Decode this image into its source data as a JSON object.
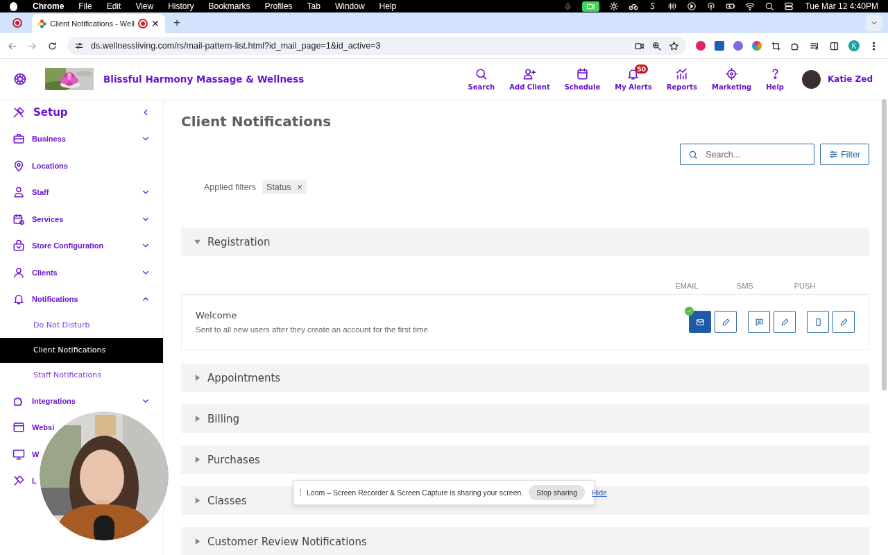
{
  "menubar": {
    "app": "Chrome",
    "menus": [
      "File",
      "Edit",
      "View",
      "History",
      "Bookmarks",
      "Profiles",
      "Tab",
      "Window",
      "Help"
    ],
    "clock": "Tue Mar 12  4:40PM"
  },
  "browser": {
    "tab_title": "Client Notifications - Well",
    "close_tab": "✕",
    "new_tab": "+",
    "url": "ds.wellnessliving.com/rs/mail-pattern-list.html?id_mail_page=1&id_active=3",
    "profile_initial": "K"
  },
  "header": {
    "business_name": "Blissful Harmony Massage & Wellness",
    "nav": [
      {
        "label": "Search"
      },
      {
        "label": "Add Client"
      },
      {
        "label": "Schedule"
      },
      {
        "label": "My Alerts",
        "badge": "50"
      },
      {
        "label": "Reports"
      },
      {
        "label": "Marketing"
      },
      {
        "label": "Help"
      }
    ],
    "user": "Katie Zed"
  },
  "sidebar": {
    "title": "Setup",
    "items": [
      {
        "label": "Business",
        "kind": "group",
        "expanded": false
      },
      {
        "label": "Locations",
        "kind": "link"
      },
      {
        "label": "Staff",
        "kind": "group",
        "expanded": false
      },
      {
        "label": "Services",
        "kind": "group",
        "expanded": false
      },
      {
        "label": "Store Configuration",
        "kind": "group",
        "expanded": false
      },
      {
        "label": "Clients",
        "kind": "group",
        "expanded": false
      },
      {
        "label": "Notifications",
        "kind": "group",
        "expanded": true,
        "children": [
          {
            "label": "Do Not Disturb",
            "selected": false
          },
          {
            "label": "Client Notifications",
            "selected": true
          },
          {
            "label": "Staff Notifications",
            "selected": false
          }
        ]
      },
      {
        "label": "Integrations",
        "kind": "group",
        "expanded": false
      },
      {
        "label": "Websi",
        "kind": "link"
      },
      {
        "label": "W",
        "kind": "link"
      },
      {
        "label": "L",
        "kind": "link"
      }
    ]
  },
  "main": {
    "title": "Client Notifications",
    "search": {
      "placeholder": "Search..."
    },
    "filter_button": "Filter",
    "applied_filters": {
      "label": "Applied filters",
      "chips": [
        {
          "label": "Status",
          "remove": "×"
        }
      ]
    },
    "sections": [
      {
        "title": "Registration",
        "expanded": true,
        "columns": [
          "EMAIL",
          "SMS",
          "PUSH"
        ],
        "items": [
          {
            "name": "Welcome",
            "description": "Sent to all new users after they create an account for the first time",
            "channels": [
              {
                "kind": "email",
                "on": true
              },
              {
                "kind": "sms",
                "on": false
              },
              {
                "kind": "push",
                "on": false
              }
            ]
          }
        ]
      },
      {
        "title": "Appointments",
        "expanded": false
      },
      {
        "title": "Billing",
        "expanded": false
      },
      {
        "title": "Purchases",
        "expanded": false
      },
      {
        "title": "Classes",
        "expanded": false
      },
      {
        "title": "Customer Review Notifications",
        "expanded": false
      }
    ]
  },
  "share_bar": {
    "message": "Loom – Screen Recorder & Screen Capture is sharing your screen.",
    "stop_button": "Stop sharing",
    "hide_link": "Hide"
  }
}
